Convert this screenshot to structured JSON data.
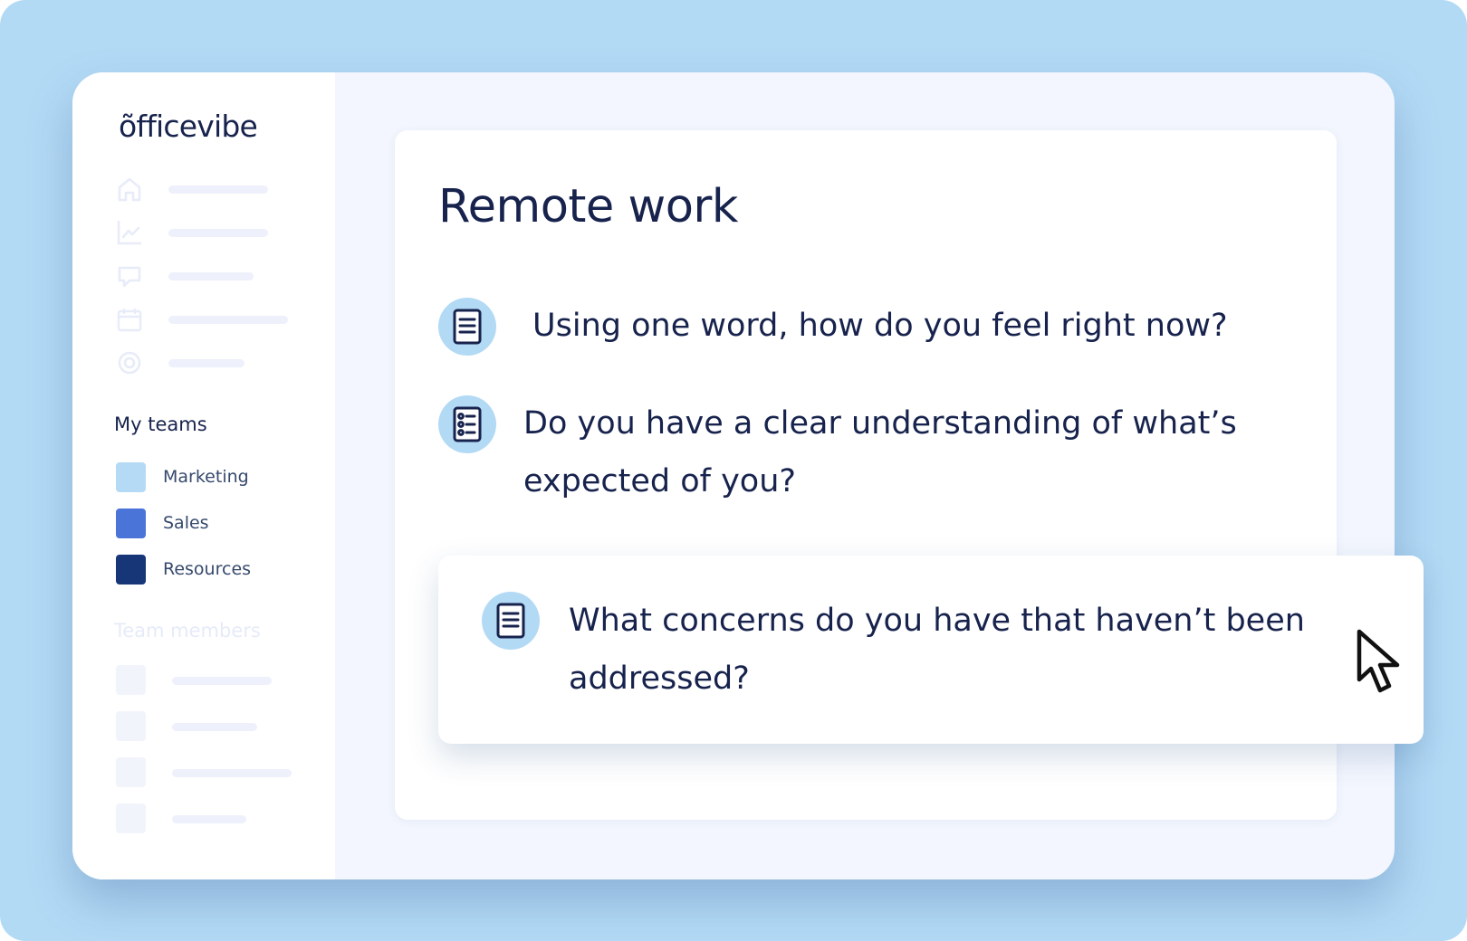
{
  "brand": {
    "logo_text": "õfficevibe"
  },
  "sidebar": {
    "nav_icons": [
      "home-icon",
      "chart-icon",
      "chat-icon",
      "calendar-icon",
      "target-icon"
    ],
    "my_teams_label": "My teams",
    "teams": [
      {
        "name": "Marketing",
        "color": "#b5daf5"
      },
      {
        "name": "Sales",
        "color": "#4a74d8"
      },
      {
        "name": "Resources",
        "color": "#163677"
      }
    ],
    "team_members_label": "Team members"
  },
  "survey": {
    "title": "Remote work",
    "questions": [
      {
        "text": "Using one word, how do you feel right now?",
        "icon": "document-icon"
      },
      {
        "text": "Do you have a clear understanding of what’s expected of you?",
        "icon": "checklist-icon"
      }
    ],
    "highlighted_question": {
      "text": "What concerns do you have that haven’t been addressed?",
      "icon": "document-icon"
    }
  },
  "colors": {
    "backdrop": "#b3daf5",
    "accent_text": "#17234d",
    "icon_circle": "#b3daf5"
  }
}
